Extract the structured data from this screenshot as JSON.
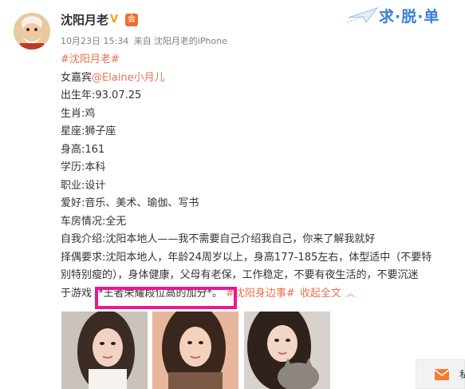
{
  "post": {
    "author": "沈阳月老",
    "time": "10月23日 15:34",
    "source_prefix": "来自",
    "source": "沈阳月老的iPhone",
    "hashtag": "#沈阳月老#",
    "guest_label": "女嘉宾",
    "guest_handle": "@Elaine小月儿",
    "birth_year": "出生年:93.07.25",
    "zodiac": "生肖:鸡",
    "constellation": "星座:狮子座",
    "height": "身高:161",
    "education": "学历:本科",
    "job": "职业:设计",
    "hobbies": "爱好:音乐、美术、瑜伽、写书",
    "car_house": "车房情况:全无",
    "intro": "自我介绍:沈阳本地人——我不需要自己介绍我自己，你来了解我就好",
    "mate_req_1": "择偶要求:沈阳本地人，年龄24周岁以上，身高177-185左右，体型适中（不要特",
    "mate_req_2": "别特别瘦的），身体健康，父母有老保，工作稳定，不要有夜生活的，不要沉迷",
    "mate_req_3_prefix": "于游戏",
    "mate_req_3_highlight": "*王者荣耀段位高的加分*。",
    "topic_tag": "#沈阳身边事#",
    "collapse_label": "收起全文",
    "chevron": "︿"
  },
  "watermark": {
    "text": "求·脱·单"
  },
  "message_box": {
    "label": "私"
  },
  "colors": {
    "link": "#eb7350",
    "highlight_border": "#e9198f",
    "watermark": "#3c7fcf"
  },
  "icons": {
    "vip": "verified-badge-icon",
    "member": "member-badge-icon",
    "envelope": "envelope-icon",
    "chevron": "chevron-up-icon"
  }
}
